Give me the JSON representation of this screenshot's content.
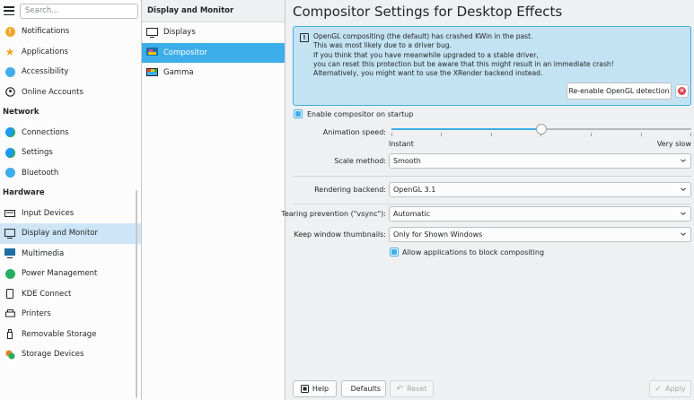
{
  "sidebar": {
    "search_placeholder": "Search...",
    "items": [
      {
        "type": "item",
        "label": "Notifications",
        "icon": "notifications-icon",
        "color": "#f5a623"
      },
      {
        "type": "item",
        "label": "Applications",
        "icon": "applications-star-icon",
        "color": "#f5a623"
      },
      {
        "type": "item",
        "label": "Accessibility",
        "icon": "accessibility-icon",
        "color": "#3daee9"
      },
      {
        "type": "item",
        "label": "Online Accounts",
        "icon": "online-accounts-icon",
        "color": "#232629"
      },
      {
        "type": "category",
        "label": "Network"
      },
      {
        "type": "item",
        "label": "Connections",
        "icon": "connections-globe-icon",
        "color": "#1d99f3"
      },
      {
        "type": "item",
        "label": "Settings",
        "icon": "network-settings-globe-icon",
        "color": "#1d99f3"
      },
      {
        "type": "item",
        "label": "Bluetooth",
        "icon": "bluetooth-icon",
        "color": "#3daee9"
      },
      {
        "type": "category",
        "label": "Hardware"
      },
      {
        "type": "item",
        "label": "Input Devices",
        "icon": "keyboard-icon",
        "color": "#232629"
      },
      {
        "type": "item",
        "label": "Display and Monitor",
        "icon": "monitor-icon",
        "color": "#232629",
        "selected": true
      },
      {
        "type": "item",
        "label": "Multimedia",
        "icon": "multimedia-icon",
        "color": "#1d6fa5"
      },
      {
        "type": "item",
        "label": "Power Management",
        "icon": "power-icon",
        "color": "#27ae60"
      },
      {
        "type": "item",
        "label": "KDE Connect",
        "icon": "phone-icon",
        "color": "#232629"
      },
      {
        "type": "item",
        "label": "Printers",
        "icon": "printer-icon",
        "color": "#232629"
      },
      {
        "type": "item",
        "label": "Removable Storage",
        "icon": "usb-drive-icon",
        "color": "#232629"
      },
      {
        "type": "item",
        "label": "Storage Devices",
        "icon": "storage-devices-icon",
        "color": "#e67e22"
      }
    ]
  },
  "midcol": {
    "title": "Display and Monitor",
    "items": [
      {
        "label": "Displays",
        "icon": "displays-icon",
        "selected": false
      },
      {
        "label": "Compositor",
        "icon": "compositor-icon",
        "selected": true
      },
      {
        "label": "Gamma",
        "icon": "gamma-icon",
        "selected": false
      }
    ]
  },
  "content": {
    "title": "Compositor Settings for Desktop Effects",
    "message_lines": [
      "OpenGL compositing (the default) has crashed KWin in the past.",
      "This was most likely due to a driver bug.",
      "If you think that you have meanwhile upgraded to a stable driver,",
      "you can reset this protection but be aware that this might result in an immediate crash!",
      "Alternatively, you might want to use the XRender backend instead."
    ],
    "reenable_label": "Re-enable OpenGL detection",
    "enable_startup_label": "Enable compositor on startup",
    "enable_startup_checked": true,
    "animation_speed_label": "Animation speed:",
    "animation_speed_fraction": 0.5,
    "slider_min_label": "Instant",
    "slider_max_label": "Very slow",
    "scale_method_label": "Scale method:",
    "scale_method_value": "Smooth",
    "rendering_backend_label": "Rendering backend:",
    "rendering_backend_value": "OpenGL 3.1",
    "tearing_label": "Tearing prevention (\"vsync\"):",
    "tearing_value": "Automatic",
    "thumbnails_label": "Keep window thumbnails:",
    "thumbnails_value": "Only for Shown Windows",
    "allow_block_label": "Allow applications to block compositing",
    "allow_block_checked": true
  },
  "footer": {
    "help_label": "Help",
    "defaults_label": "Defaults",
    "reset_label": "Reset",
    "apply_label": "Apply"
  },
  "colors": {
    "accent": "#3daee9",
    "selection_light": "#cde5f7",
    "message_bg": "#c4e3f2",
    "close_red": "#da4453"
  }
}
